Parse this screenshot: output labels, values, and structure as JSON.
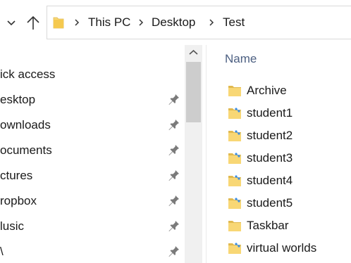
{
  "address_bar": {
    "breadcrumbs": [
      "This PC",
      "Desktop",
      "Test"
    ]
  },
  "nav_pane": {
    "items": [
      {
        "label": "ick access",
        "pinned": false
      },
      {
        "label": "esktop",
        "pinned": true
      },
      {
        "label": "ownloads",
        "pinned": true
      },
      {
        "label": "ocuments",
        "pinned": true
      },
      {
        "label": "ctures",
        "pinned": true
      },
      {
        "label": "ropbox",
        "pinned": true
      },
      {
        "label": "lusic",
        "pinned": true
      },
      {
        "label": "\\",
        "pinned": true
      }
    ]
  },
  "content": {
    "column_header": "Name",
    "files": [
      {
        "name": "Archive",
        "icon": "folder-icon"
      },
      {
        "name": "student1",
        "icon": "shared-folder-icon"
      },
      {
        "name": "student2",
        "icon": "shared-folder-icon"
      },
      {
        "name": "student3",
        "icon": "shared-folder-icon"
      },
      {
        "name": "student4",
        "icon": "shared-folder-icon"
      },
      {
        "name": "student5",
        "icon": "shared-folder-icon"
      },
      {
        "name": "Taskbar",
        "icon": "folder-icon"
      },
      {
        "name": "virtual worlds",
        "icon": "shared-folder-icon"
      }
    ]
  },
  "colors": {
    "folder_yellow": "#f8d775",
    "folder_dark": "#e0b94f",
    "share_blue": "#3a8ee6",
    "header_text": "#4d6082",
    "scroll_track": "#f0f0f0",
    "scroll_thumb": "#cdcdcd"
  }
}
